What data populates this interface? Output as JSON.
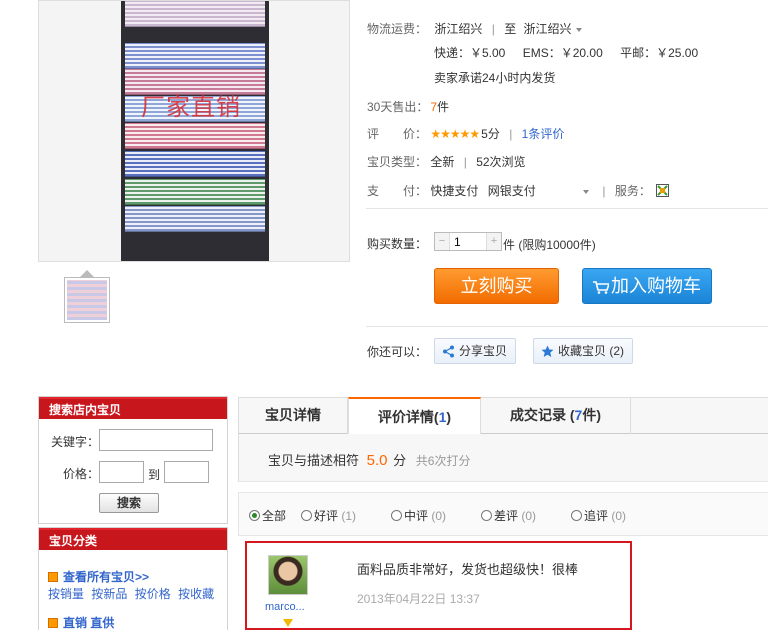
{
  "gallery": {
    "watermark": "厂家直销"
  },
  "detail": {
    "shipping_label": "物流运费：",
    "ship_from": "浙江绍兴",
    "ship_to_sep": "至",
    "ship_to": "浙江绍兴",
    "express": "快递：￥5.00",
    "ems": "EMS：￥20.00",
    "surface": "平邮：￥25.00",
    "promise": "卖家承诺24小时内发货",
    "sold_label": "30天售出：",
    "sold_value": "7",
    "sold_unit": "件",
    "rating_label": "评　　价：",
    "rating_stars": "★★★★★",
    "rating_score": "5分",
    "rating_count": "1条评价",
    "type_label": "宝贝类型：",
    "type_value": "全新",
    "views": "52次浏览",
    "pay_label": "支　　付：",
    "pay_1": "快捷支付",
    "pay_2": "网银支付",
    "service_label": "服务："
  },
  "purchase": {
    "qty_label": "购买数量：",
    "qty_minus": "−",
    "qty_value": "1",
    "qty_plus": "+",
    "qty_unit": "件 (限购10000件)",
    "buy_now": "立刻购买",
    "add_cart": "加入购物车",
    "also_label": "你还可以：",
    "share": "分享宝贝",
    "collect": "收藏宝贝 (2)"
  },
  "sidebar": {
    "search_title": "搜索店内宝贝",
    "keyword_label": "关键字：",
    "price_label": "价格：",
    "price_to": "到",
    "search_btn": "搜索",
    "cat_title": "宝贝分类",
    "view_all": "查看所有宝贝>>",
    "sort_sales": "按销量",
    "sort_new": "按新品",
    "sort_price": "按价格",
    "sort_fav": "按收藏",
    "cat_direct": "直销 直供"
  },
  "tabs": {
    "detail": "宝贝详情",
    "reviews": "评价详情",
    "reviews_count": "1",
    "records": "成交记录",
    "records_count": "7",
    "records_unit": "件"
  },
  "rating_summary": {
    "label": "宝贝与描述相符",
    "score": "5.0",
    "unit": "分",
    "count": "共6次打分"
  },
  "filters": {
    "all": "全部",
    "good": "好评",
    "good_n": "(1)",
    "mid": "中评",
    "mid_n": "(0)",
    "bad": "差评",
    "bad_n": "(0)",
    "follow": "追评",
    "follow_n": "(0)"
  },
  "review": {
    "user": "marco...",
    "text": "面料品质非常好，发货也超级快！很棒",
    "date": "2013年04月22日 13:37"
  },
  "colors": {
    "accent_orange": "#f60",
    "sidebar_red": "#c8161d",
    "buy_orange": "#f26c00",
    "cart_blue": "#1b84d6",
    "highlight_border": "#d5181f"
  }
}
